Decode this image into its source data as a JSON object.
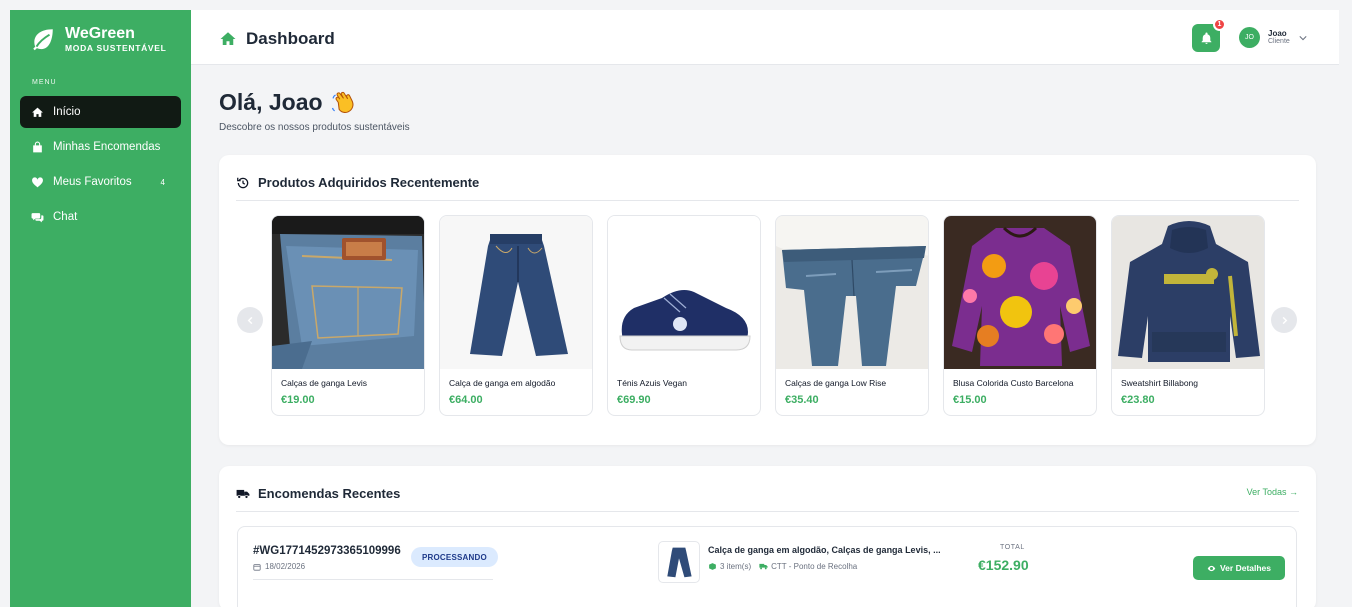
{
  "brand": {
    "name": "WeGreen",
    "tagline": "MODA SUSTENTÁVEL",
    "color": "#3dae63"
  },
  "sidebar": {
    "menu_label": "MENU",
    "items": [
      {
        "label": "Início",
        "icon": "home-icon",
        "active": true
      },
      {
        "label": "Minhas Encomendas",
        "icon": "shopping-bag-icon"
      },
      {
        "label": "Meus Favoritos",
        "icon": "heart-icon",
        "badge": "4"
      },
      {
        "label": "Chat",
        "icon": "chat-icon"
      }
    ]
  },
  "header": {
    "title": "Dashboard",
    "notifications": "1",
    "user": {
      "initials": "JO",
      "name": "Joao",
      "role": "Cliente"
    }
  },
  "greeting": {
    "title": "Olá, Joao",
    "subtitle": "Descobre os nossos produtos sustentáveis"
  },
  "recent_products": {
    "title": "Produtos Adquiridos Recentemente",
    "items": [
      {
        "name": "Calças de ganga Levis",
        "price": "€19.00"
      },
      {
        "name": "Calça de ganga em algodão",
        "price": "€64.00"
      },
      {
        "name": "Ténis Azuis Vegan",
        "price": "€69.90"
      },
      {
        "name": "Calças de ganga Low Rise",
        "price": "€35.40"
      },
      {
        "name": "Blusa Colorida Custo Barcelona",
        "price": "€15.00"
      },
      {
        "name": "Sweatshirt Billabong",
        "price": "€23.80"
      }
    ]
  },
  "recent_orders": {
    "title": "Encomendas Recentes",
    "see_all": "Ver Todas →",
    "orders": [
      {
        "id": "#WG1771452973365109996",
        "date": "18/02/2026",
        "status": "PROCESSANDO",
        "items_text": "Calça de ganga em algodão, Calças de ganga Levis, ...",
        "item_count": "3 item(s)",
        "shipping": "CTT - Ponto de Recolha",
        "total_label": "TOTAL",
        "total": "€152.90",
        "details_label": "Ver Detalhes"
      }
    ]
  }
}
